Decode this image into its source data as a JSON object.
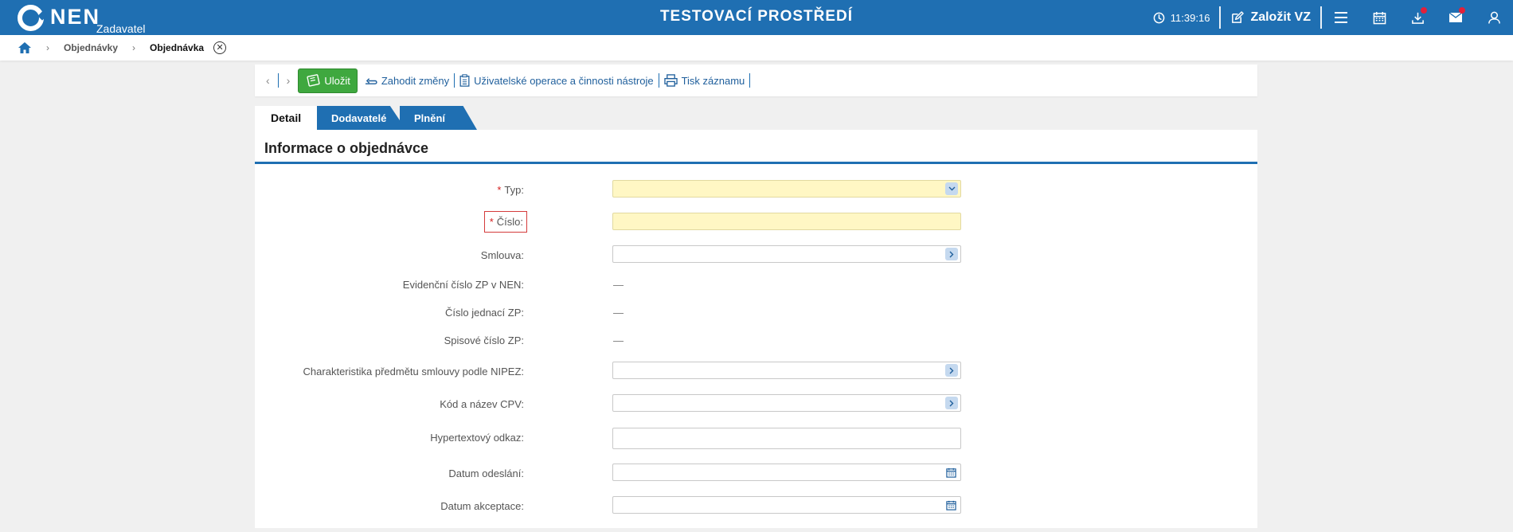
{
  "app": {
    "logo_text": "NEN",
    "logo_sub": "Zadavatel",
    "env_title": "TESTOVACÍ PROSTŘEDÍ",
    "clock": "11:39:16",
    "new_vz_label": "Založit VZ"
  },
  "breadcrumb": {
    "items": [
      "Objednávky"
    ],
    "current": "Objednávka"
  },
  "toolbar": {
    "save_label": "Uložit",
    "discard_label": "Zahodit změny",
    "user_ops_label": "Uživatelské operace a činnosti nástroje",
    "print_label": "Tisk záznamu"
  },
  "tabs": [
    {
      "label": "Detail",
      "active": true
    },
    {
      "label": "Dodavatelé",
      "active": false
    },
    {
      "label": "Plnění",
      "active": false
    }
  ],
  "panel": {
    "title": "Informace o objednávce"
  },
  "form": {
    "typ": {
      "label": "Typ:",
      "required": true,
      "value": ""
    },
    "cislo": {
      "label": "Číslo:",
      "required": true,
      "value": ""
    },
    "smlouva": {
      "label": "Smlouva:",
      "value": ""
    },
    "evidencni": {
      "label": "Evidenční číslo ZP v NEN:",
      "value": "—"
    },
    "jednaci": {
      "label": "Číslo jednací ZP:",
      "value": "—"
    },
    "spisove": {
      "label": "Spisové číslo ZP:",
      "value": "—"
    },
    "nipez": {
      "label": "Charakteristika předmětu smlouvy podle NIPEZ:",
      "value": ""
    },
    "cpv": {
      "label": "Kód a název CPV:",
      "value": ""
    },
    "odkaz": {
      "label": "Hypertextový odkaz:",
      "value": ""
    },
    "odeslani": {
      "label": "Datum odeslání:",
      "value": ""
    },
    "akceptace": {
      "label": "Datum akceptace:",
      "value": ""
    }
  },
  "colors": {
    "brand": "#1f6fb2",
    "save_green": "#3fa83f",
    "required_field": "#fff7c4",
    "notification_dot": "#e2203a"
  }
}
